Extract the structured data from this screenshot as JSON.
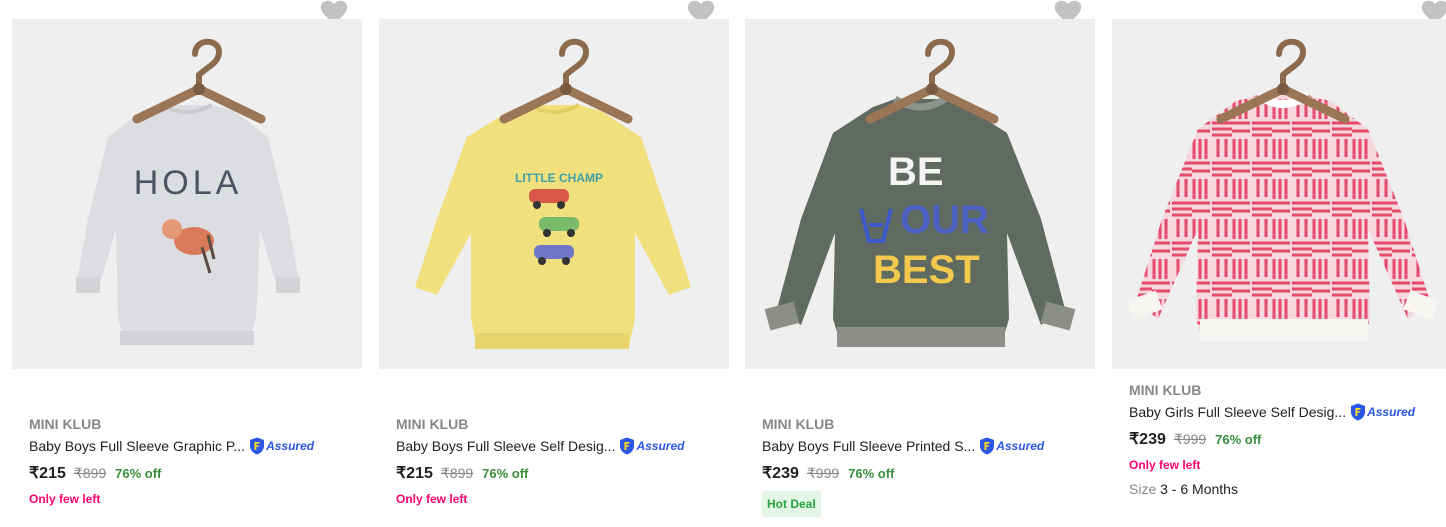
{
  "colors": {
    "brand": "#878787",
    "price": "#212121",
    "discount": "#388e3c",
    "few_left": "#ff0073",
    "assured": "#2a55e5",
    "hot_deal_bg": "#e3f6e5",
    "hot_deal_text": "#26a541"
  },
  "products": [
    {
      "brand": "MINI KLUB",
      "title": "Baby Boys Full Sleeve Graphic P...",
      "assured": "Assured",
      "price": "₹215",
      "mrp": "₹899",
      "discount": "76% off",
      "tag": "Only few left",
      "image_text": "HOLA",
      "icons": {
        "wishlist": "heart-icon"
      }
    },
    {
      "brand": "MINI KLUB",
      "title": "Baby Boys Full Sleeve Self Desig...",
      "assured": "Assured",
      "price": "₹215",
      "mrp": "₹899",
      "discount": "76% off",
      "tag": "Only few left",
      "image_text": "LITTLE CHAMP",
      "icons": {
        "wishlist": "heart-icon"
      }
    },
    {
      "brand": "MINI KLUB",
      "title": "Baby Boys Full Sleeve Printed S...",
      "assured": "Assured",
      "price": "₹239",
      "mrp": "₹999",
      "discount": "76% off",
      "tag": "Hot Deal",
      "image_text": [
        "BE",
        "OUR",
        "BEST"
      ],
      "icons": {
        "wishlist": "heart-icon"
      }
    },
    {
      "brand": "MINI KLUB",
      "title": "Baby Girls Full Sleeve Self Desig...",
      "assured": "Assured",
      "price": "₹239",
      "mrp": "₹999",
      "discount": "76% off",
      "tag": "Only few left",
      "size_label": "Size",
      "size_value": "3 - 6 Months",
      "icons": {
        "wishlist": "heart-icon"
      }
    }
  ]
}
